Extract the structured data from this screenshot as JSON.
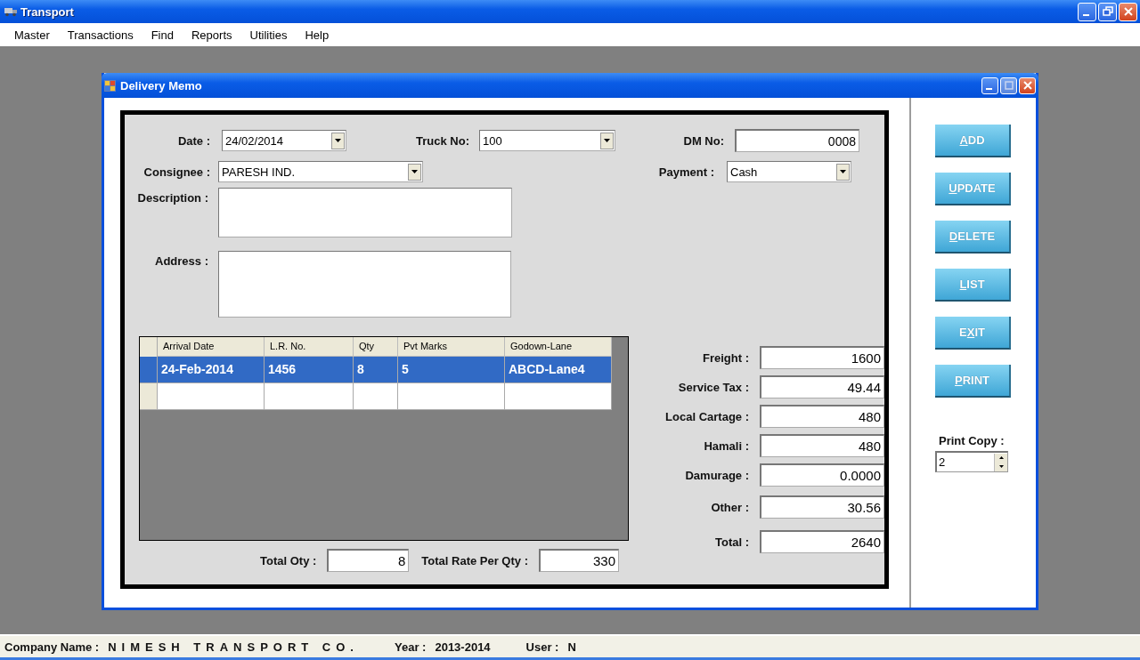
{
  "window": {
    "title": "Transport"
  },
  "menu": [
    "Master",
    "Transactions",
    "Find",
    "Reports",
    "Utilities",
    "Help"
  ],
  "child_window": {
    "title": "Delivery Memo"
  },
  "header": {
    "date": {
      "label": "Date :",
      "value": "24/02/2014"
    },
    "truck_no": {
      "label": "Truck No:",
      "value": "100"
    },
    "dm_no": {
      "label": "DM No:",
      "value": "0008"
    },
    "consignee": {
      "label": "Consignee :",
      "value": "PARESH IND."
    },
    "payment": {
      "label": "Payment  :",
      "value": "Cash"
    },
    "description": {
      "label": "Description :"
    },
    "address": {
      "label": "Address  :"
    }
  },
  "grid": {
    "columns": [
      "Arrival Date",
      "L.R. No.",
      "Qty",
      "Pvt Marks",
      "Godown-Lane"
    ],
    "rows": [
      {
        "cells": [
          "24-Feb-2014",
          "1456",
          "8",
          "5",
          "ABCD-Lane4"
        ],
        "selected": true
      }
    ]
  },
  "charges": [
    {
      "label": "Freight :",
      "value": "1600"
    },
    {
      "label": "Service Tax :",
      "value": "49.44"
    },
    {
      "label": "Local Cartage :",
      "value": "480"
    },
    {
      "label": "Hamali :",
      "value": "480"
    },
    {
      "label": "Damurage :",
      "value": "0.0000"
    },
    {
      "label": "Other :",
      "value": "30.56"
    },
    {
      "label": "Total :",
      "value": "2640"
    }
  ],
  "totals": [
    {
      "label": "Total Oty :",
      "value": "8"
    },
    {
      "label": "Total Rate Per Qty :",
      "value": "330"
    }
  ],
  "buttons": [
    {
      "label_parts": [
        {
          "text": "A",
          "underlined": true
        },
        {
          "text": "DD",
          "underlined": false
        }
      ]
    },
    {
      "label_parts": [
        {
          "text": "U",
          "underlined": true
        },
        {
          "text": "PDATE",
          "underlined": false
        }
      ]
    },
    {
      "label_parts": [
        {
          "text": "D",
          "underlined": true
        },
        {
          "text": "ELETE",
          "underlined": false
        }
      ]
    },
    {
      "label_parts": [
        {
          "text": "L",
          "underlined": true
        },
        {
          "text": "IST",
          "underlined": false
        }
      ]
    },
    {
      "label_parts": [
        {
          "text": "E",
          "underlined": false
        },
        {
          "text": "X",
          "underlined": true
        },
        {
          "text": "IT",
          "underlined": false
        }
      ]
    },
    {
      "label_parts": [
        {
          "text": "P",
          "underlined": true
        },
        {
          "text": "RINT",
          "underlined": false
        }
      ]
    }
  ],
  "print_copy": {
    "label": "Print Copy :",
    "value": "2"
  },
  "status_bar": [
    {
      "label": "Company Name :",
      "value": "NIMESH TRANSPORT CO.",
      "kind": "spaced"
    },
    {
      "label": "Year :",
      "value": "2013-2014",
      "kind": "plain"
    },
    {
      "label": "User :",
      "value": "N",
      "kind": "plain"
    }
  ]
}
